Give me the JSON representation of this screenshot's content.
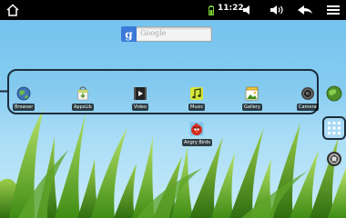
{
  "status_bar": {
    "time": "11:22",
    "icons": [
      "home-icon",
      "battery-icon",
      "volume-down-icon",
      "volume-up-icon",
      "back-icon",
      "menu-icon"
    ]
  },
  "search": {
    "placeholder": "Google",
    "logo_letter": "g"
  },
  "dock": {
    "apps": [
      {
        "label": "Browser",
        "icon": "globe-icon"
      },
      {
        "label": "AppsLib",
        "icon": "shopping-bag-icon"
      },
      {
        "label": "Video",
        "icon": "video-icon"
      },
      {
        "label": "Music",
        "icon": "music-note-icon"
      },
      {
        "label": "Gallery",
        "icon": "gallery-icon"
      },
      {
        "label": "Camera",
        "icon": "camera-icon"
      }
    ]
  },
  "desktop_apps": [
    {
      "label": "Angry Birds",
      "icon": "angry-bird-icon"
    }
  ],
  "side_panel": {
    "buttons": [
      "globe-icon",
      "all-apps-grid-icon",
      "media-button-icon"
    ]
  },
  "colors": {
    "status_bar": "#000000",
    "sky": "#86ccf1",
    "dock_border": "#1c2c3c",
    "grass": "#6fb52c"
  }
}
